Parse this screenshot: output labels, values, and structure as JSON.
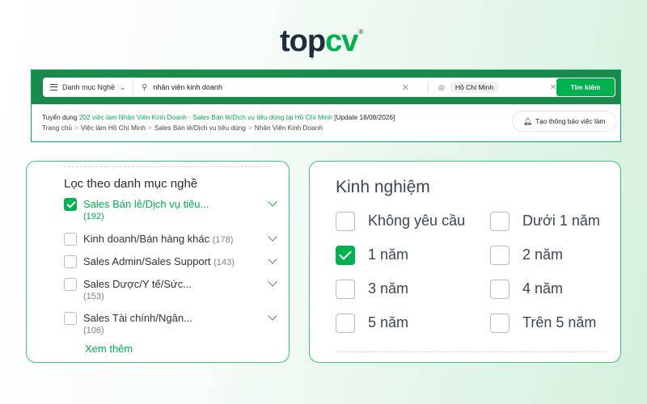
{
  "brand": {
    "logo_top": "top",
    "logo_cv": "cv",
    "logo_reg": "®",
    "accent": "#00b14f",
    "dark": "#198a4b"
  },
  "search": {
    "category_label": "Danh mục Nghề",
    "keyword_value": "nhân viên kinh doanh",
    "location_value": "Hồ Chí Minh",
    "button_label": "Tìm kiếm",
    "icons": {
      "category": "list-icon",
      "chevron": "chevron-down-icon",
      "search": "search-icon",
      "clear": "close-icon",
      "location": "map-pin-icon"
    }
  },
  "result": {
    "prefix": "Tuyển dụng ",
    "count_text": "202 việc làm Nhân Viên Kinh Doanh - Sales Bán lẻ/Dịch vụ tiêu dùng tại Hồ Chí Minh",
    "suffix": " [Update 18/08/2026]"
  },
  "breadcrumb": [
    "Trang chủ",
    "Việc làm Hồ Chí Minh",
    "Sales Bán lẻ/Dịch vụ tiêu dùng",
    "Nhân Viên Kinh Doanh"
  ],
  "alert_button": {
    "label": "Tạo thông báo việc làm",
    "icon": "bell-icon"
  },
  "category_filter": {
    "title": "Lọc theo danh mục nghề",
    "items": [
      {
        "label": "Sales Bán lẻ/Dịch vụ tiêu...",
        "count": "(192)",
        "checked": true
      },
      {
        "label": "Kinh doanh/Bán hàng khác",
        "count": "(178)",
        "checked": false
      },
      {
        "label": "Sales Admin/Sales Support",
        "count": "(143)",
        "checked": false
      },
      {
        "label": "Sales Dược/Y tế/Sức...",
        "count": "(153)",
        "checked": false
      },
      {
        "label": "Sales Tài chính/Ngân...",
        "count": "(106)",
        "checked": false
      }
    ],
    "see_more": "Xem thêm"
  },
  "experience_filter": {
    "title": "Kinh nghiệm",
    "options": [
      {
        "label": "Không yêu cầu",
        "checked": false
      },
      {
        "label": "Dưới 1 năm",
        "checked": false
      },
      {
        "label": "1 năm",
        "checked": true
      },
      {
        "label": "2 năm",
        "checked": false
      },
      {
        "label": "3 năm",
        "checked": false
      },
      {
        "label": "4 năm",
        "checked": false
      },
      {
        "label": "5 năm",
        "checked": false
      },
      {
        "label": "Trên 5 năm",
        "checked": false
      }
    ]
  }
}
